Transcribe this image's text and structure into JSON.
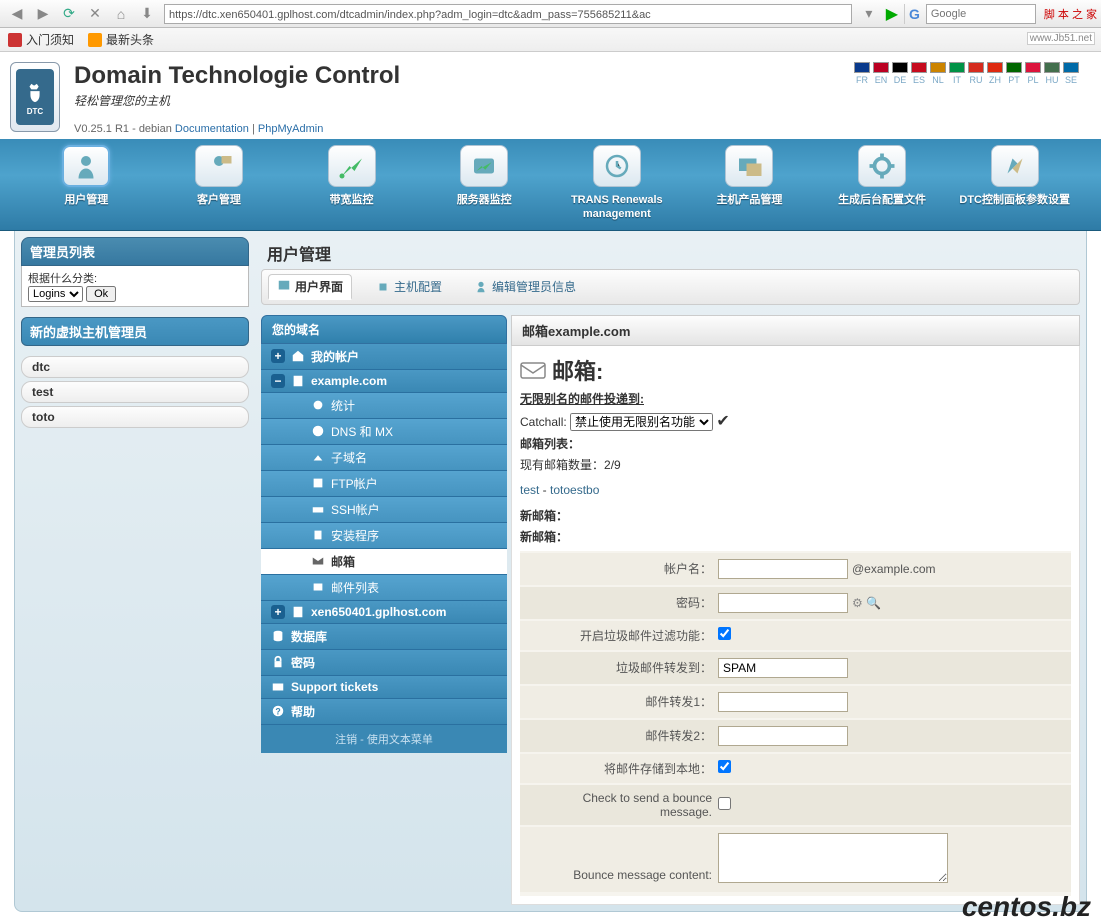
{
  "browser": {
    "url": "https://dtc.xen650401.gplhost.com/dtcadmin/index.php?adm_login=dtc&adm_pass=755685211&ac",
    "search_placeholder": "Google",
    "site_brand": "脚 本 之 家",
    "site_url": "www.Jb51.net",
    "bookmarks": [
      "入门须知",
      "最新头条"
    ]
  },
  "header": {
    "title": "Domain Technologie Control",
    "subtitle": "轻松管理您的主机",
    "version": "V0.25.1 R1 - debian ",
    "doc": "Documentation",
    "pma": "PhpMyAdmin",
    "langs": [
      "FR",
      "EN",
      "DE",
      "ES",
      "NL",
      "IT",
      "RU",
      "ZH",
      "PT",
      "PL",
      "HU",
      "SE"
    ],
    "flag_colors": [
      "#0a3a8c",
      "#bb0022",
      "#000",
      "#c60b1e",
      "#cc8400",
      "#009246",
      "#d52b1e",
      "#de2910",
      "#006600",
      "#dc143c",
      "#436F4D",
      "#006aa7"
    ]
  },
  "nav": [
    {
      "label": "用户管理",
      "selected": true
    },
    {
      "label": "客户管理"
    },
    {
      "label": "带宽监控"
    },
    {
      "label": "服务器监控"
    },
    {
      "label": "TRANS Renewals management"
    },
    {
      "label": "主机产品管理"
    },
    {
      "label": "生成后台配置文件"
    },
    {
      "label": "DTC控制面板参数设置"
    }
  ],
  "left": {
    "admin_list_title": "管理员列表",
    "group_by": "根据什么分类:",
    "group_select": "Logins",
    "ok": "Ok",
    "new_vhost_admin": "新的虚拟主机管理员",
    "admins": [
      "dtc",
      "test",
      "toto"
    ]
  },
  "page": {
    "title": "用户管理",
    "tabs": [
      {
        "label": "用户界面",
        "active": true
      },
      {
        "label": "主机配置"
      },
      {
        "label": "编辑管理员信息"
      }
    ]
  },
  "tree": {
    "header": "您的域名",
    "my_account": "我的帐户",
    "domain_open": "example.com",
    "sub_items": [
      "统计",
      "DNS 和 MX",
      "子域名",
      "FTP帐户",
      "SSH帐户",
      "安装程序",
      "邮箱",
      "邮件列表"
    ],
    "sub_selected_index": 6,
    "domain_closed": "xen650401.gplhost.com",
    "db": "数据库",
    "pwd": "密码",
    "support": "Support tickets",
    "help": "帮助",
    "logout": "注销 - 使用文本菜单"
  },
  "mail": {
    "header_prefix": "邮箱",
    "header_domain": "example.com",
    "section_title": "邮箱:",
    "catchall_header": "无限别名的邮件投递到:",
    "catchall_label": "Catchall:",
    "catchall_select": "禁止使用无限别名功能",
    "list_label": "邮箱列表：",
    "count_label": "现有邮箱数量：",
    "count_value": "2/9",
    "links": [
      "test",
      "totoestbo"
    ],
    "new_label": "新邮箱：",
    "new_label2": "新邮箱：",
    "form": {
      "account": "帐户名：",
      "account_suffix": "@example.com",
      "password": "密码：",
      "spam_filter": "开启垃圾邮件过滤功能：",
      "spam_fwd": "垃圾邮件转发到：",
      "spam_fwd_val": "SPAM",
      "fwd1": "邮件转发1：",
      "fwd2": "邮件转发2：",
      "store_local": "将邮件存储到本地：",
      "bounce_check": "Check to send a bounce message.",
      "bounce_content": "Bounce message content:"
    }
  },
  "watermark": "centos.bz"
}
